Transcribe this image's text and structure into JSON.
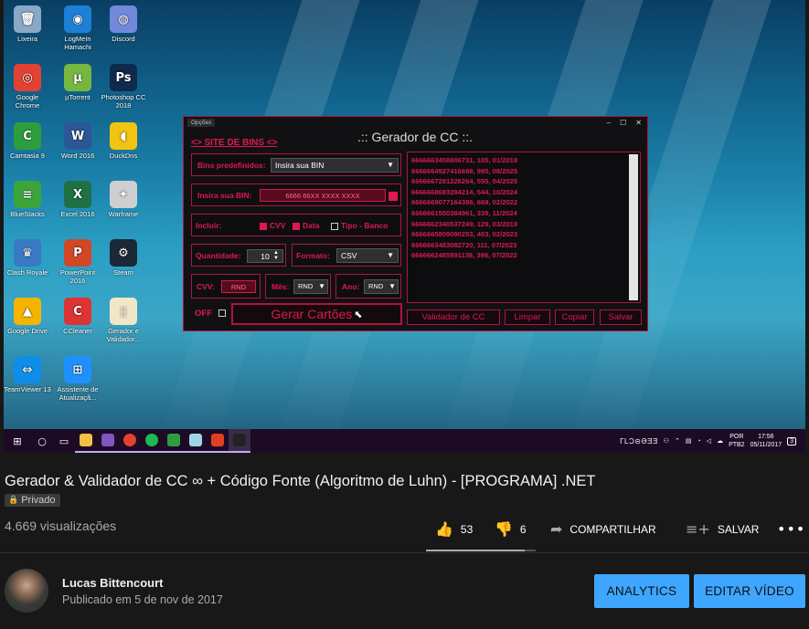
{
  "desktop": {
    "icons": [
      {
        "label": "Lixeira",
        "icon": "recycle-bin-icon",
        "color": "#8aa8c8",
        "glyph": "🗑"
      },
      {
        "label": "LogMeIn Hamachi",
        "icon": "hamachi-icon",
        "color": "#1d7fd6",
        "glyph": "◉"
      },
      {
        "label": "Discord",
        "icon": "discord-icon",
        "color": "#7289da",
        "glyph": "◍"
      },
      {
        "label": "Google Chrome",
        "icon": "chrome-icon",
        "color": "#e34133",
        "glyph": "◎"
      },
      {
        "label": "µTorrent",
        "icon": "utorrent-icon",
        "color": "#76b83f",
        "glyph": "µ"
      },
      {
        "label": "Photoshop CC 2018",
        "icon": "photoshop-icon",
        "color": "#0f2a4a",
        "glyph": "Ps"
      },
      {
        "label": "Camtasia 9",
        "icon": "camtasia-icon",
        "color": "#2d9e3d",
        "glyph": "C"
      },
      {
        "label": "Word 2016",
        "icon": "word-icon",
        "color": "#2b5797",
        "glyph": "W"
      },
      {
        "label": "DuckDns",
        "icon": "duckdns-icon",
        "color": "#f1c40f",
        "glyph": "◖"
      },
      {
        "label": "BlueStacks",
        "icon": "bluestacks-icon",
        "color": "#3ba43b",
        "glyph": "≡"
      },
      {
        "label": "Excel 2016",
        "icon": "excel-icon",
        "color": "#1e7145",
        "glyph": "X"
      },
      {
        "label": "Warframe",
        "icon": "warframe-icon",
        "color": "#cfcfcf",
        "glyph": "✦"
      },
      {
        "label": "Clash Royale",
        "icon": "clash-royale-icon",
        "color": "#3a79c4",
        "glyph": "♛"
      },
      {
        "label": "PowerPoint 2016",
        "icon": "powerpoint-icon",
        "color": "#d24726",
        "glyph": "P"
      },
      {
        "label": "Steam",
        "icon": "steam-icon",
        "color": "#1b2838",
        "glyph": "⚙"
      },
      {
        "label": "Google Drive",
        "icon": "google-drive-icon",
        "color": "#f4b400",
        "glyph": "▲"
      },
      {
        "label": "CCleaner",
        "icon": "ccleaner-icon",
        "color": "#d33",
        "glyph": "C"
      },
      {
        "label": "Gerador e Validador...",
        "icon": "file-icon",
        "color": "#f1e6c8",
        "glyph": "▯"
      },
      {
        "label": "TeamViewer 13",
        "icon": "teamviewer-icon",
        "color": "#0e8ee9",
        "glyph": "⇔"
      },
      {
        "label": "Assistente de Atualizaçã...",
        "icon": "windows-update-icon",
        "color": "#1e90ff",
        "glyph": "⊞"
      }
    ],
    "taskbar": {
      "tray_text": "ΓLƆ⊝ƏƎƎ",
      "lang": "POR",
      "layout": "PTB2",
      "time": "17:56",
      "date": "05/11/2017",
      "notifications": "3"
    }
  },
  "app": {
    "menu": "Opções",
    "title": ".:: Gerador de CC ::.",
    "site_link": "<> SITE DE BINS <>",
    "bins_label": "Bins predefinidos:",
    "bins_value": "Insira sua BIN",
    "bin_label": "Insira sua BIN:",
    "bin_value": "6666 66XX XXXX XXXX",
    "include_label": "Incluir:",
    "include_options": [
      {
        "label": "CVV",
        "checked": true
      },
      {
        "label": "Data",
        "checked": true
      },
      {
        "label": "Tipo - Banco",
        "checked": false
      }
    ],
    "qty_label": "Quantidade:",
    "qty_value": "10",
    "format_label": "Formato:",
    "format_value": "CSV",
    "cvv_label": "CVV:",
    "cvv_value": "RND",
    "month_label": "Mês:",
    "month_value": "RND",
    "year_label": "Ano:",
    "year_value": "RND",
    "off_label": "OFF",
    "generate_button": "Gerar Cartões",
    "output_lines": [
      "6666663458806731, 105, 01/2018",
      "6666664927416698, 985, 08/2025",
      "6666667281226264, 555, 04/2025",
      "6666668693284214, 544, 10/2024",
      "6666669077164386, 669, 02/2022",
      "6666661550384961, 339, 11/2024",
      "6666662340537249, 129, 03/2019",
      "6666665809090253, 403, 02/2023",
      "6666663483082720, 111, 07/2023",
      "6666662485891138, 398, 07/2022"
    ],
    "buttons": {
      "validator": "Validador de CC",
      "clear": "Limpar",
      "copy": "Copiar",
      "save": "Salvar"
    }
  },
  "video": {
    "title": "Gerador & Validador de CC ∞ + Código Fonte (Algoritmo de Luhn) - [PROGRAMA] .NET",
    "privacy": "Privado",
    "views": "4.669 visualizações",
    "likes": "53",
    "dislikes": "6",
    "like_ratio": 0.9,
    "share": "COMPARTILHAR",
    "save": "SALVAR"
  },
  "channel": {
    "name": "Lucas Bittencourt",
    "published": "Publicado em 5 de nov de 2017",
    "analytics_button": "ANALYTICS",
    "edit_button": "EDITAR VÍDEO"
  },
  "colors": {
    "accent": "#e0184f",
    "youtube_button": "#3ea6ff",
    "background": "#181818"
  }
}
